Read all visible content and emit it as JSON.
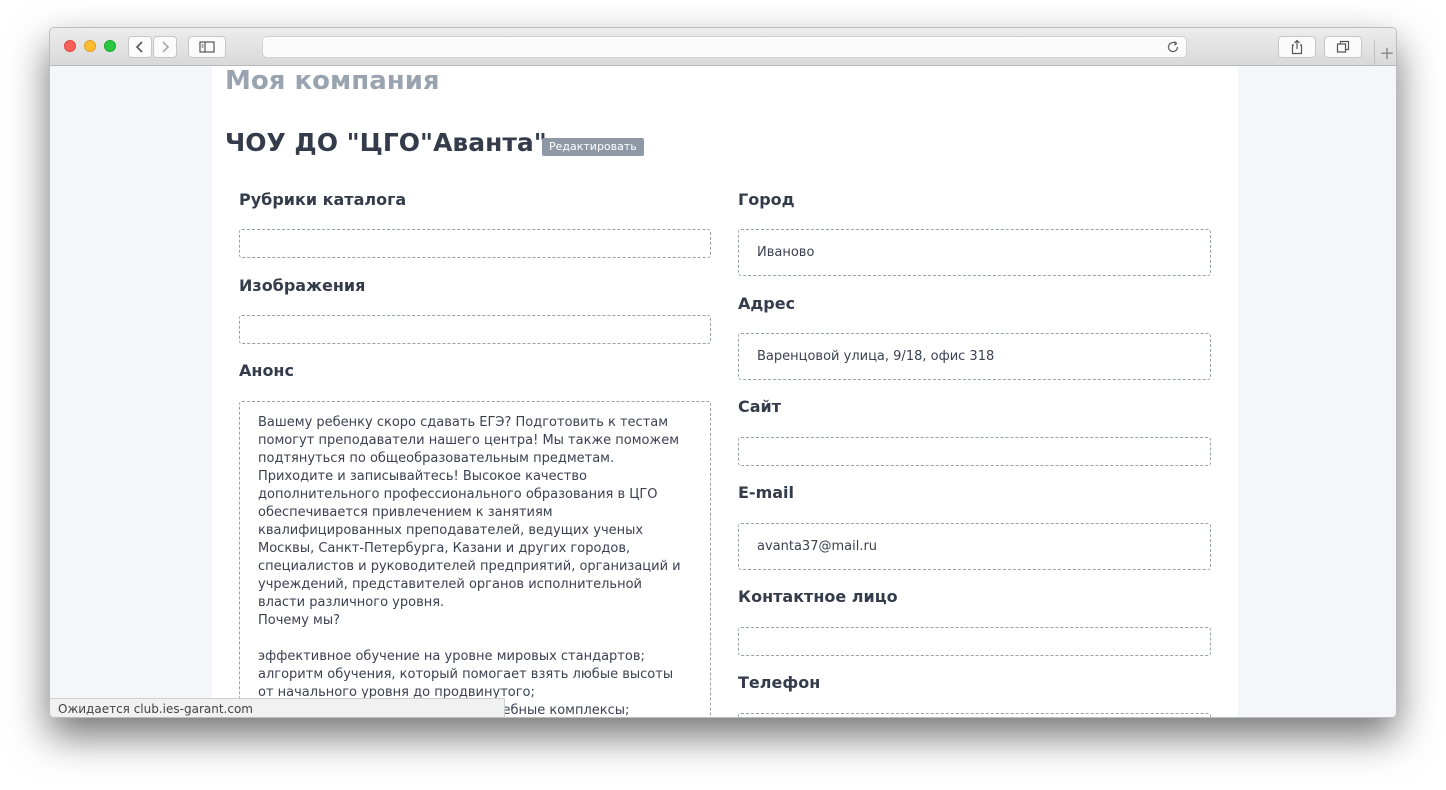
{
  "browser": {
    "status_text": "Ожидается club.ies-garant.com",
    "new_tab_symbol": "+"
  },
  "page": {
    "title": "Моя компания",
    "company_name": "ЧОУ ДО \"ЦГО\"Аванта\"",
    "edit_label": "Редактировать"
  },
  "left": {
    "rubrics_label": "Рубрики каталога",
    "rubrics_value": "",
    "images_label": "Изображения",
    "images_value": "",
    "announce_label": "Анонс",
    "announce_text": "Вашему ребенку скоро сдавать ЕГЭ? Подготовить к тестам помогут преподаватели нашего центра! Мы также поможем подтянуться по общеобразовательным предметам. Приходите и записывайтесь! Высокое качество дополнительного профессионального образования в ЦГО обеспечивается привлечением к занятиям квалифицированных преподавателей, ведущих ученых Москвы, Санкт-Петербурга, Казани и других городов, специалистов и руководителей предприятий, организаций и учреждений, представителей органов исполнительной власти различного уровня.\nПочему мы?\n\nэффективное обучение на уровне мировых стандартов;\nалгоритм обучения, который помогает взять любые высоты от начального уровня до продвинутого;\nувлекательные многоуровневые учебные комплексы;\nсистема коммуникативных тренировочных упражнений;\nпостроение обучения на основе грамматических явлений.Вашему"
  },
  "right": {
    "city_label": "Город",
    "city_value": "Иваново",
    "address_label": "Адрес",
    "address_value": "Варенцовой улица, 9/18, офис 318",
    "site_label": "Сайт",
    "site_value": "",
    "email_label": "E-mail",
    "email_value": "avanta37@mail.ru",
    "contact_label": "Контактное лицо",
    "contact_value": "",
    "phone_label": "Телефон",
    "phone_value": ""
  },
  "colors": {
    "title_muted": "#9aa4b0",
    "heading": "#343b4a",
    "edit_button": "#8f99a6",
    "page_bg": "#f4f6fa"
  }
}
